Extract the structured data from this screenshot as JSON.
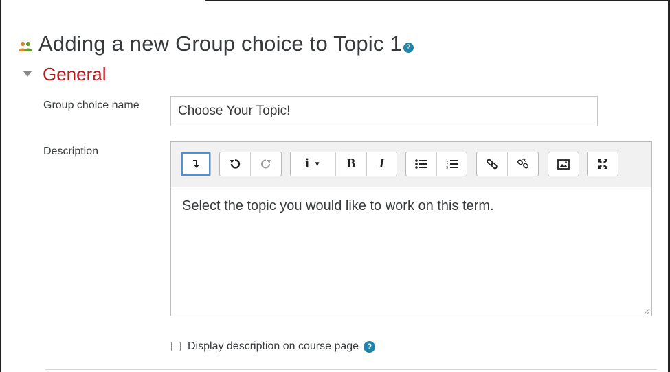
{
  "page": {
    "title": "Adding a new Group choice to Topic 1",
    "help_icon": "question-icon",
    "module_icon": "group-icon"
  },
  "section": {
    "title": "General",
    "expanded": true
  },
  "form": {
    "name_label": "Group choice name",
    "name_value": "Choose Your Topic!",
    "description_label": "Description",
    "description_text": "Select the topic you would like to work on this term.",
    "display_description_label": "Display description on course page",
    "display_description_checked": false
  },
  "toolbar": {
    "buttons": [
      {
        "name": "toggle-toolbar",
        "icon": "arrow-down-icon"
      },
      {
        "name": "undo",
        "icon": "undo-icon"
      },
      {
        "name": "redo",
        "icon": "redo-icon"
      },
      {
        "name": "info",
        "icon": "info-dropdown-icon"
      },
      {
        "name": "bold",
        "label": "B"
      },
      {
        "name": "italic",
        "label": "I"
      },
      {
        "name": "unordered-list",
        "icon": "bullet-list-icon"
      },
      {
        "name": "ordered-list",
        "icon": "numbered-list-icon"
      },
      {
        "name": "link",
        "icon": "link-icon"
      },
      {
        "name": "unlink",
        "icon": "unlink-icon"
      },
      {
        "name": "image",
        "icon": "image-icon"
      },
      {
        "name": "fullscreen",
        "icon": "expand-icon"
      }
    ]
  },
  "colors": {
    "section_title": "#b21e1e",
    "help_icon": "#1f84a8",
    "active_outline": "#4f8fd6"
  }
}
